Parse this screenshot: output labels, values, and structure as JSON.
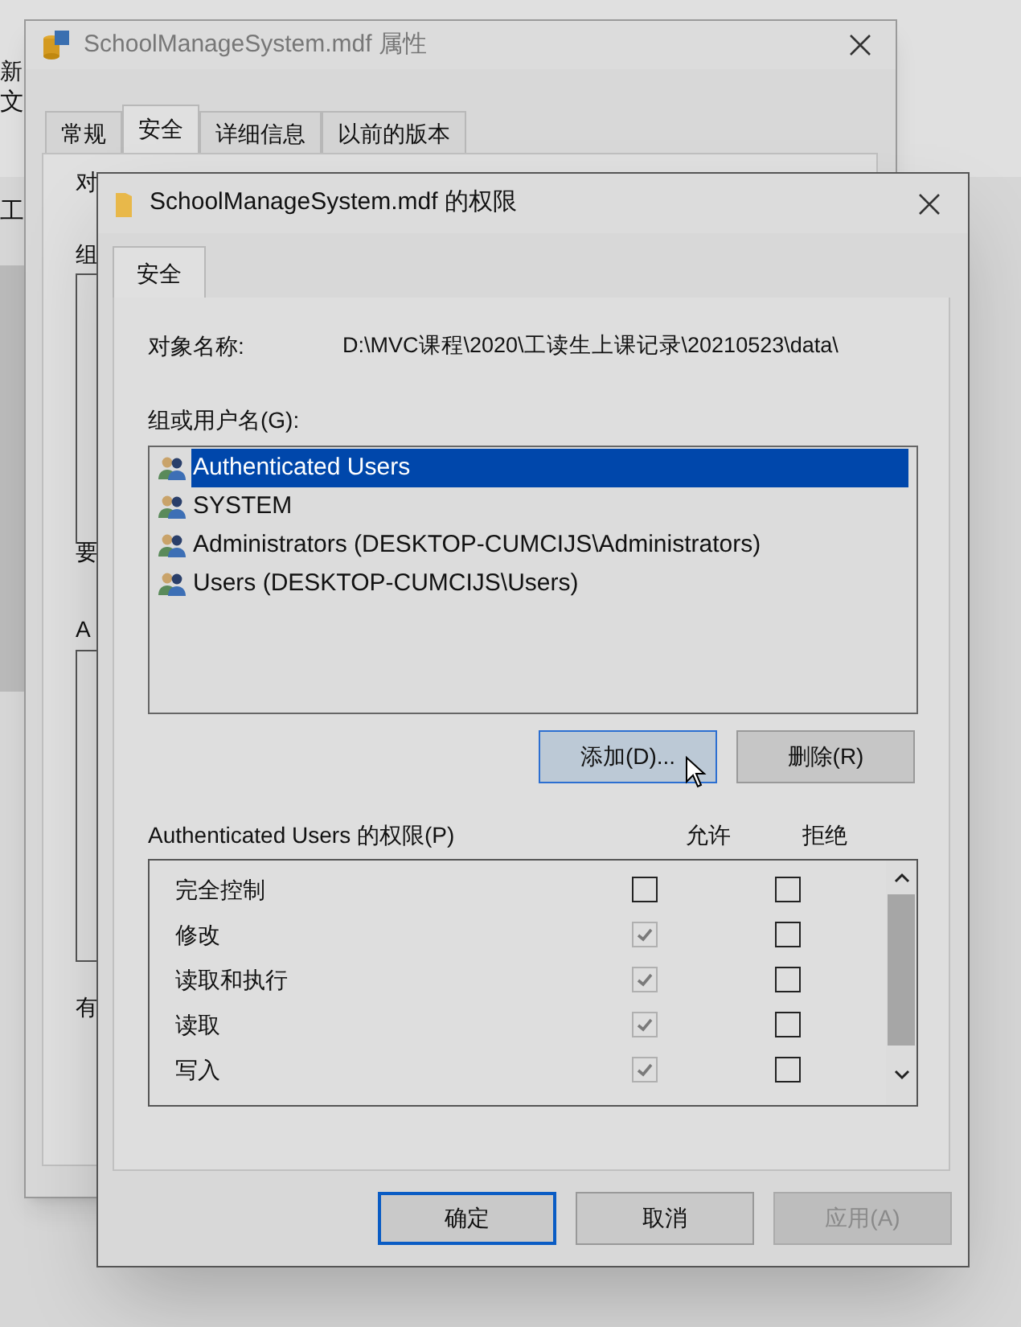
{
  "desktop": {
    "fragments": [
      "新",
      "文",
      "工"
    ]
  },
  "back_window": {
    "title": "SchoolManageSystem.mdf 属性",
    "tabs": [
      {
        "label": "常规",
        "selected": false
      },
      {
        "label": "安全",
        "selected": true
      },
      {
        "label": "详细信息",
        "selected": false
      },
      {
        "label": "以前的版本",
        "selected": false
      }
    ],
    "fragments": [
      "对",
      "组",
      "要",
      "A",
      "有"
    ]
  },
  "dialog": {
    "title": "SchoolManageSystem.mdf 的权限",
    "tabs": [
      {
        "label": "安全",
        "selected": true
      }
    ],
    "object_label": "对象名称:",
    "object_value": "D:\\MVC课程\\2020\\工读生上课记录\\20210523\\data\\",
    "group_label": "组或用户名(G):",
    "users": [
      {
        "name": "Authenticated Users",
        "selected": true
      },
      {
        "name": "SYSTEM",
        "selected": false
      },
      {
        "name": "Administrators (DESKTOP-CUMCIJS\\Administrators)",
        "selected": false
      },
      {
        "name": "Users (DESKTOP-CUMCIJS\\Users)",
        "selected": false
      }
    ],
    "user_buttons": [
      {
        "label": "添加(D)...",
        "hovered": true
      },
      {
        "label": "删除(R)",
        "hovered": false
      }
    ],
    "permissions_label": "Authenticated Users 的权限(P)",
    "allow_header": "允许",
    "deny_header": "拒绝",
    "permissions": [
      {
        "name": "完全控制",
        "allow": false,
        "allow_disabled": false,
        "deny": false
      },
      {
        "name": "修改",
        "allow": true,
        "allow_disabled": true,
        "deny": false
      },
      {
        "name": "读取和执行",
        "allow": true,
        "allow_disabled": true,
        "deny": false
      },
      {
        "name": "读取",
        "allow": true,
        "allow_disabled": true,
        "deny": false
      },
      {
        "name": "写入",
        "allow": true,
        "allow_disabled": true,
        "deny": false
      }
    ],
    "buttons": [
      {
        "label": "确定",
        "kind": "default"
      },
      {
        "label": "取消",
        "kind": "normal"
      },
      {
        "label": "应用(A)",
        "kind": "disabled"
      }
    ]
  }
}
